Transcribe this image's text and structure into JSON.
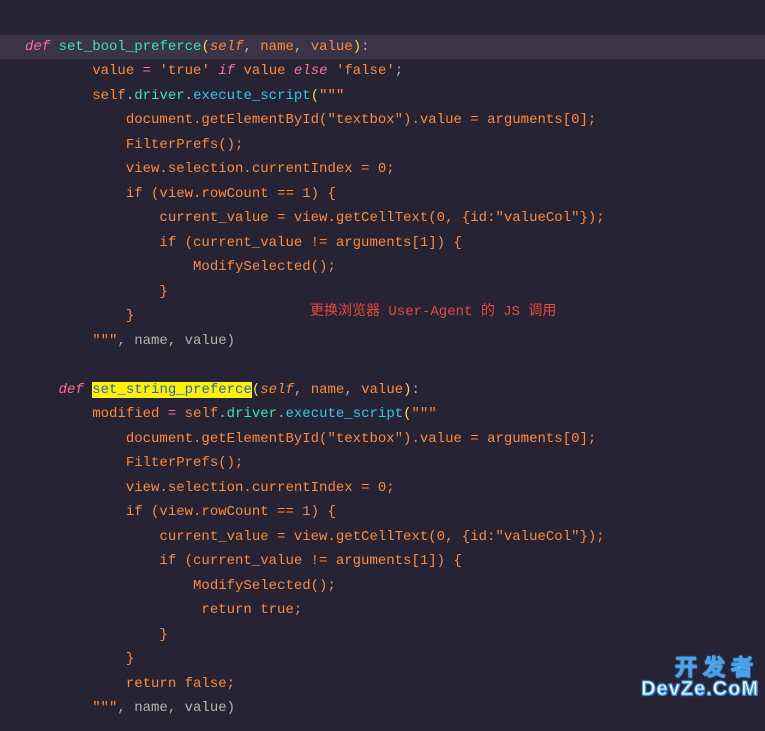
{
  "code": {
    "fn1": {
      "def": "def",
      "name": "set_bool_preferce",
      "params": {
        "self": "self",
        "name": "name",
        "value": "value"
      },
      "l2": {
        "lhs": "value",
        "op": "=",
        "s1": "'true'",
        "kw_if": "if",
        "cond": "value",
        "kw_else": "else",
        "s2": "'false'"
      },
      "l3": {
        "obj": "self",
        "p1": "driver",
        "m1": "execute_script",
        "triple_open": "\"\"\""
      },
      "body": {
        "b1": "            document.getElementById(\"textbox\").value = arguments[0];",
        "b2": "            FilterPrefs();",
        "b3": "            view.selection.currentIndex = 0;",
        "b4": "            if (view.rowCount == 1) {",
        "b5": "                current_value = view.getCellText(0, {id:\"valueCol\"});",
        "b6": "                if (current_value != arguments[1]) {",
        "b7": "                    ModifySelected();",
        "b8": "                }",
        "b9": "            }",
        "close": "        \"\"\"",
        "args": ", name, value)"
      }
    },
    "fn2": {
      "def": "def",
      "name": "set_string_preferce",
      "params": {
        "self": "self",
        "name": "name",
        "value": "value"
      },
      "l2": {
        "lhs": "modified",
        "op": "=",
        "obj": "self",
        "p1": "driver",
        "m1": "execute_script",
        "triple_open": "\"\"\""
      },
      "body": {
        "b1": "            document.getElementById(\"textbox\").value = arguments[0];",
        "b2": "            FilterPrefs();",
        "b3": "            view.selection.currentIndex = 0;",
        "b4": "            if (view.rowCount == 1) {",
        "b5": "                current_value = view.getCellText(0, {id:\"valueCol\"});",
        "b6": "                if (current_value != arguments[1]) {",
        "b7": "                    ModifySelected();",
        "b8": "                     return true;",
        "b9": "                }",
        "b10": "            }",
        "b11": "            return false;",
        "close": "        \"\"\"",
        "args": ", name, value)"
      }
    }
  },
  "annotation": "更换浏览器 User-Agent 的 JS 调用",
  "watermark": {
    "top": "开发者",
    "bottom": "DevZe.CoM"
  }
}
